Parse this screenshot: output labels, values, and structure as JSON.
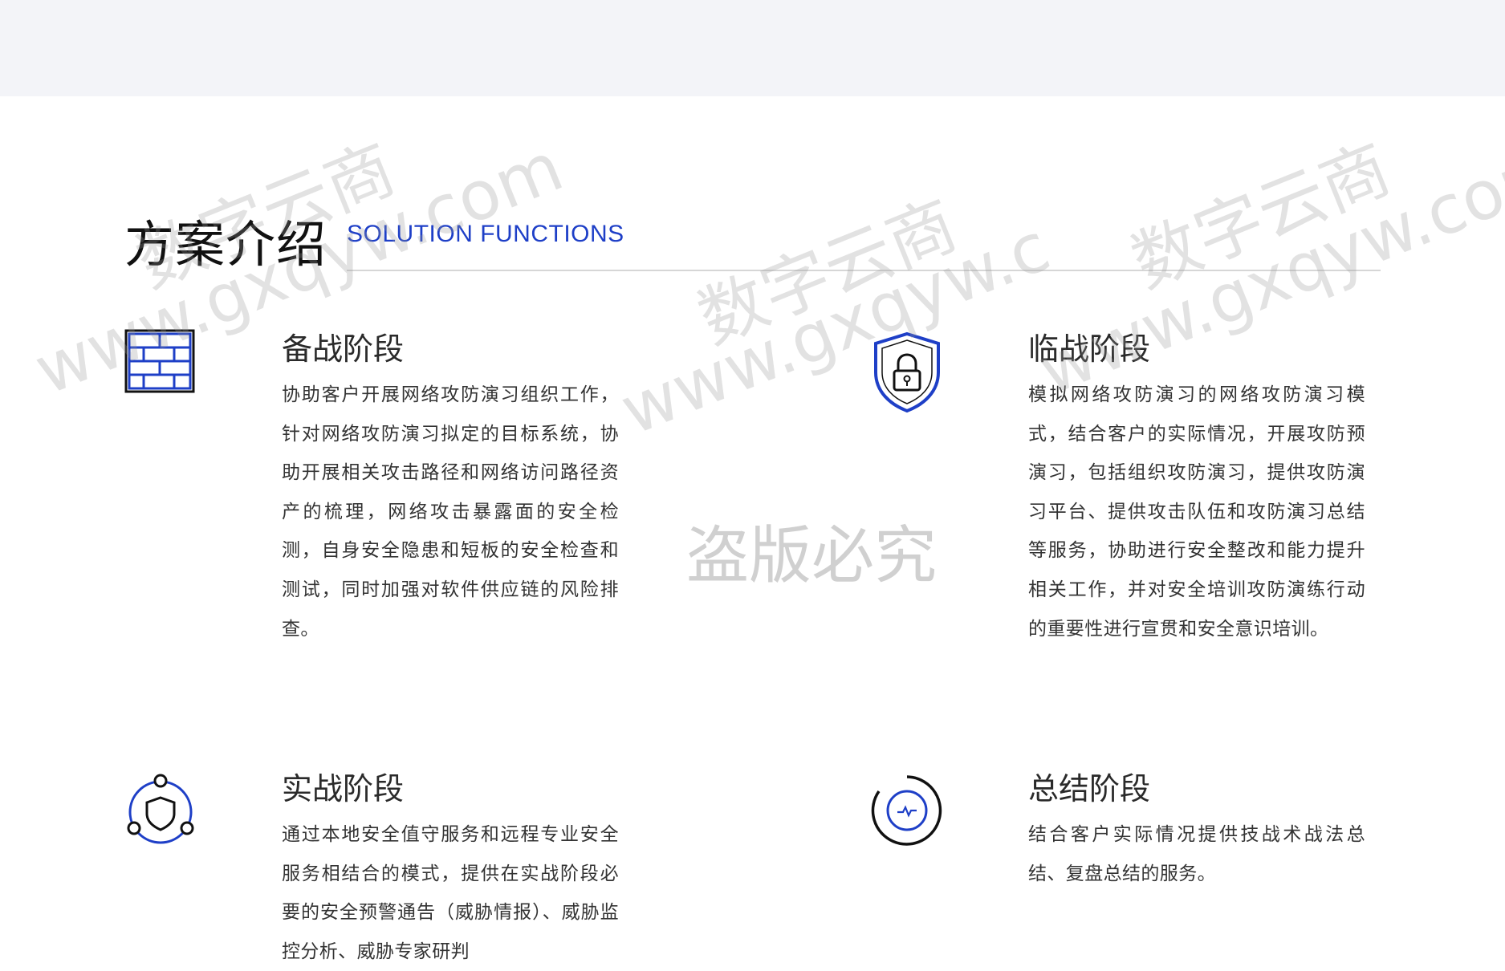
{
  "section": {
    "title_cn": "方案介绍",
    "title_en": "SOLUTION FUNCTIONS"
  },
  "colors": {
    "accent": "#1e3fc7",
    "heading_text": "#2a2a2a",
    "body_text": "#333333",
    "rule": "#d6d6d6",
    "top_band": "#f3f4f8"
  },
  "cards": [
    {
      "icon": "brick-wall-icon",
      "title": "备战阶段",
      "text": "协助客户开展网络攻防演习组织工作，针对网络攻防演习拟定的目标系统，协助开展相关攻击路径和网络访问路径资产的梳理，网络攻击暴露面的安全检测，自身安全隐患和短板的安全检查和测试，同时加强对软件供应链的风险排查。"
    },
    {
      "icon": "shield-lock-icon",
      "title": "临战阶段",
      "text": "模拟网络攻防演习的网络攻防演习模式，结合客户的实际情况，开展攻防预演习，包括组织攻防演习，提供攻防演习平台、提供攻击队伍和攻防演习总结等服务，协助进行安全整改和能力提升相关工作，并对安全培训攻防演练行动的重要性进行宣贯和安全意识培训。"
    },
    {
      "icon": "shield-network-icon",
      "title": "实战阶段",
      "text": "通过本地安全值守服务和远程专业安全服务相结合的模式，提供在实战阶段必要的安全预警通告（威胁情报）、威胁监控分析、威胁专家研判"
    },
    {
      "icon": "summary-monitor-icon",
      "title": "总结阶段",
      "text": "结合客户实际情况提供技战术战法总结、复盘总结的服务。"
    }
  ],
  "watermarks": {
    "brand": "数字云商",
    "site": "www.gxqyw.com",
    "site_partial": "www.gxqyw.c",
    "piracy": "盗版必究"
  }
}
